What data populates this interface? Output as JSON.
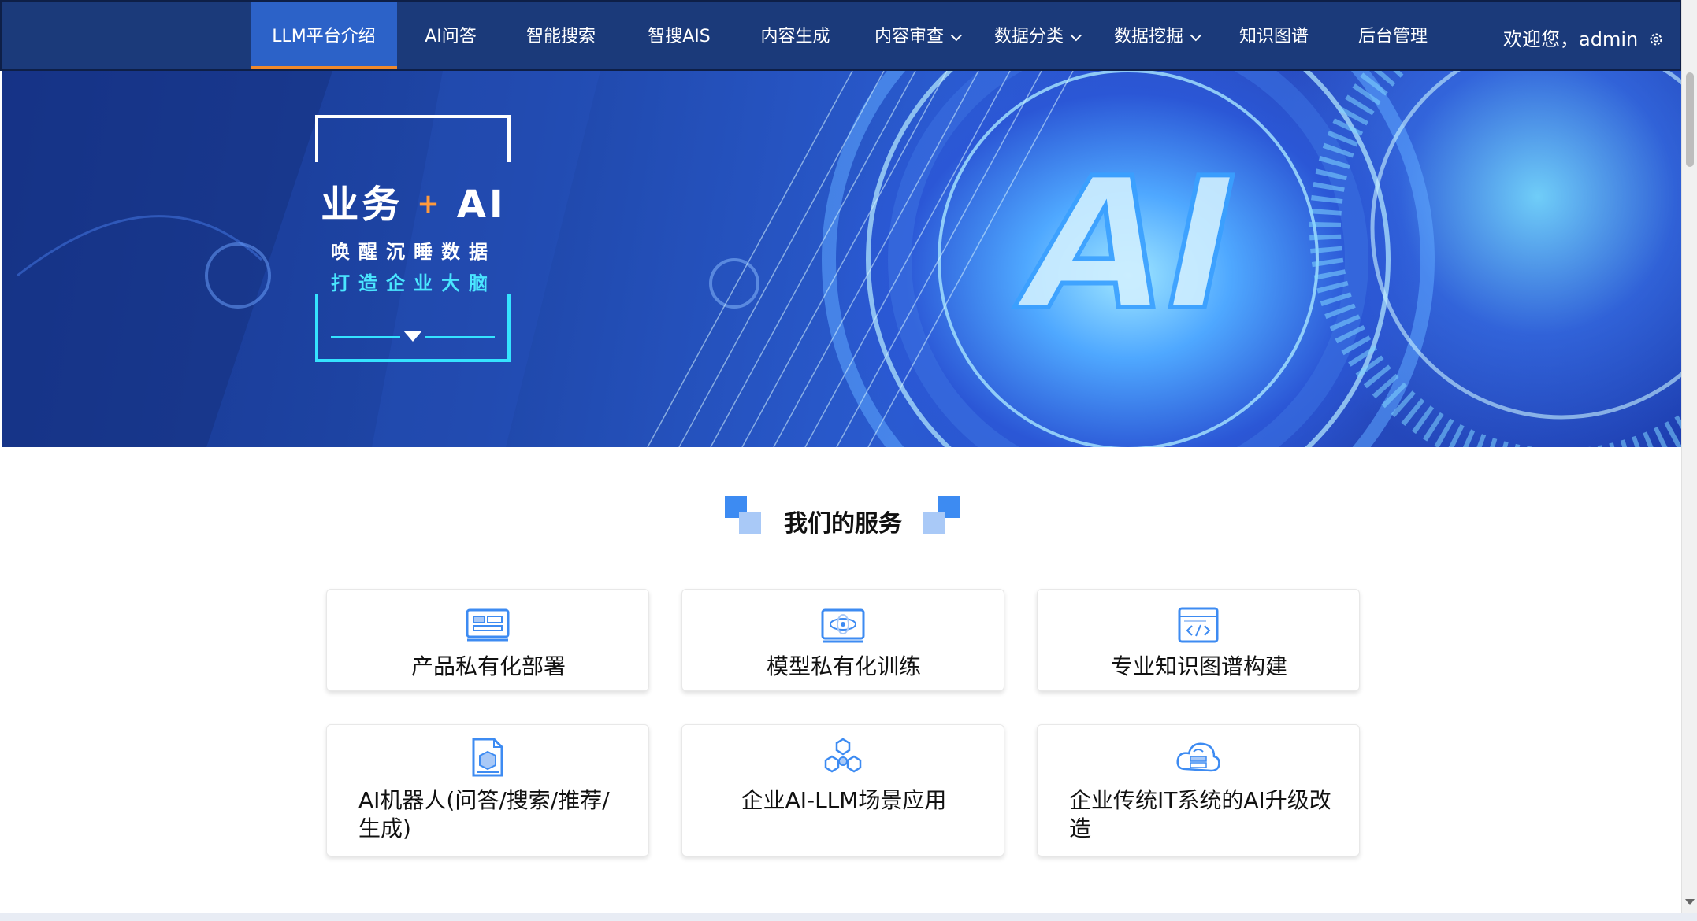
{
  "nav": {
    "items": [
      {
        "label": "LLM平台介绍",
        "active": true,
        "dropdown": false
      },
      {
        "label": "AI问答",
        "active": false,
        "dropdown": false
      },
      {
        "label": "智能搜索",
        "active": false,
        "dropdown": false
      },
      {
        "label": "智搜AIS",
        "active": false,
        "dropdown": false
      },
      {
        "label": "内容生成",
        "active": false,
        "dropdown": false
      },
      {
        "label": "内容审查",
        "active": false,
        "dropdown": true
      },
      {
        "label": "数据分类",
        "active": false,
        "dropdown": true
      },
      {
        "label": "数据挖掘",
        "active": false,
        "dropdown": true
      },
      {
        "label": "知识图谱",
        "active": false,
        "dropdown": false
      },
      {
        "label": "后台管理",
        "active": false,
        "dropdown": false
      }
    ],
    "welcome": "欢迎您，admin",
    "settings_icon": "gear-icon"
  },
  "banner": {
    "title_left": "业务",
    "title_plus": "+",
    "title_right": "AI",
    "line1": "唤醒沉睡数据",
    "line2": "打造企业大脑",
    "big_text": "AI"
  },
  "services": {
    "title": "我们的服务",
    "cards": [
      {
        "label": "产品私有化部署",
        "icon": "server-deploy-icon"
      },
      {
        "label": "模型私有化训练",
        "icon": "model-training-icon"
      },
      {
        "label": "专业知识图谱构建",
        "icon": "code-window-icon"
      },
      {
        "label": "AI机器人(问答/搜索/推荐/生成)",
        "icon": "document-cube-icon"
      },
      {
        "label": "企业AI-LLM场景应用",
        "icon": "hexagon-network-icon"
      },
      {
        "label": "企业传统IT系统的AI升级改造",
        "icon": "cloud-server-icon"
      }
    ]
  },
  "colors": {
    "nav_bg": "#1b3a7a",
    "nav_active": "#2c62c8",
    "active_underline": "#f08a2c",
    "accent_blue": "#3d8bf2",
    "cyan": "#4ae6ff"
  }
}
